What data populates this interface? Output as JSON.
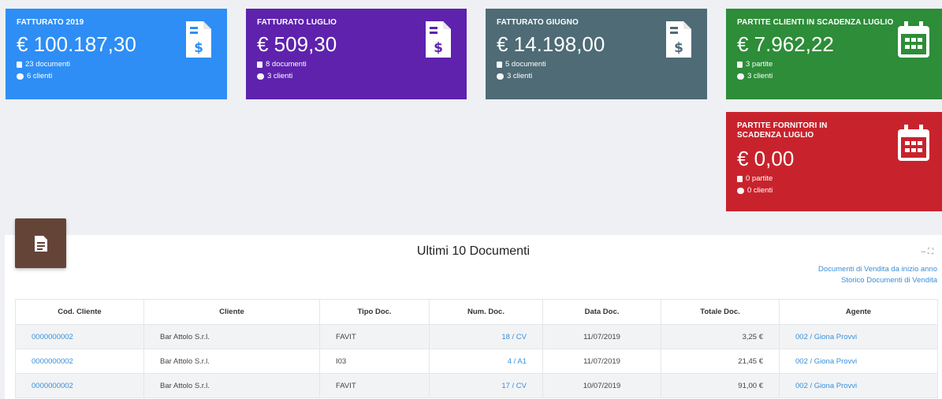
{
  "cards": [
    {
      "title": "FATTURATO 2019",
      "value": "€ 100.187,30",
      "line1": "23 documenti",
      "line2": "6 clienti",
      "icon": "invoice-dollar-icon"
    },
    {
      "title": "FATTURATO LUGLIO",
      "value": "€ 509,30",
      "line1": "8 documenti",
      "line2": "3 clienti",
      "icon": "invoice-dollar-icon"
    },
    {
      "title": "FATTURATO GIUGNO",
      "value": "€ 14.198,00",
      "line1": "5 documenti",
      "line2": "3 clienti",
      "icon": "invoice-dollar-icon"
    },
    {
      "title": "PARTITE CLIENTI IN SCADENZA LUGLIO",
      "value": "€ 7.962,22",
      "line1": "3 partite",
      "line2": "3 clienti",
      "icon": "calendar-icon"
    },
    {
      "title": "PARTITE FORNITORI IN SCADENZA LUGLIO",
      "value": "€ 0,00",
      "line1": "0 partite",
      "line2": "0 clienti",
      "icon": "calendar-icon"
    }
  ],
  "colors": {
    "blue": "#2e8ef5",
    "purple": "#5e22ad",
    "slate": "#4e6b76",
    "green": "#2d8d38",
    "red": "#c8232c",
    "tab": "#654438",
    "link": "#3a8fd8"
  },
  "panel": {
    "title": "Ultimi 10 Documenti",
    "link1": "Documenti di Vendita da inizio anno",
    "link2": "Storico Documenti di Vendita",
    "columns": [
      "Cod. Cliente",
      "Cliente",
      "Tipo Doc.",
      "Num. Doc.",
      "Data Doc.",
      "Totale Doc.",
      "Agente"
    ],
    "rows": [
      [
        "0000000002",
        "Bar Attolo S.r.l.",
        "FAVIT",
        "18 / CV",
        "11/07/2019",
        "3,25 €",
        "002 / Giona Provvi"
      ],
      [
        "0000000002",
        "Bar Attolo S.r.l.",
        "I03",
        "4 / A1",
        "11/07/2019",
        "21,45 €",
        "002 / Giona Provvi"
      ],
      [
        "0000000002",
        "Bar Attolo S.r.l.",
        "FAVIT",
        "17 / CV",
        "10/07/2019",
        "91,00 €",
        "002 / Giona Provvi"
      ]
    ]
  }
}
